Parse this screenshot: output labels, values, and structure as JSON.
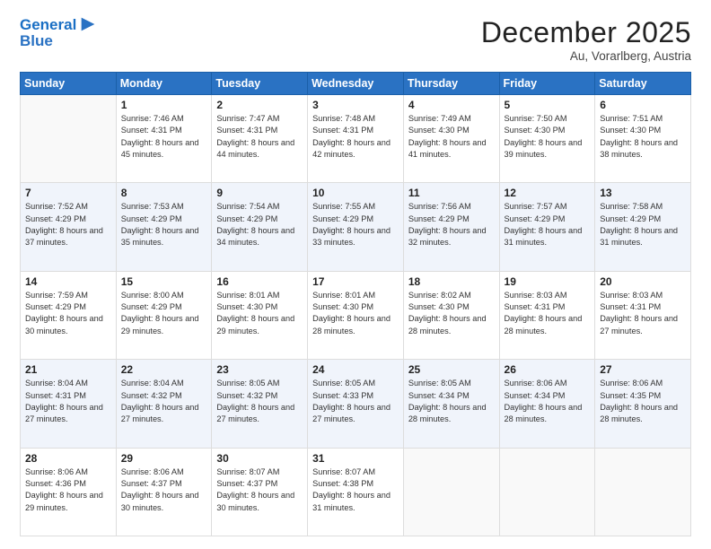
{
  "logo": {
    "line1": "General",
    "line2": "Blue",
    "icon": "▶"
  },
  "header": {
    "month": "December 2025",
    "location": "Au, Vorarlberg, Austria"
  },
  "days": [
    "Sunday",
    "Monday",
    "Tuesday",
    "Wednesday",
    "Thursday",
    "Friday",
    "Saturday"
  ],
  "weeks": [
    [
      {
        "num": "",
        "sunrise": "",
        "sunset": "",
        "daylight": ""
      },
      {
        "num": "1",
        "sunrise": "7:46 AM",
        "sunset": "4:31 PM",
        "daylight": "8 hours and 45 minutes."
      },
      {
        "num": "2",
        "sunrise": "7:47 AM",
        "sunset": "4:31 PM",
        "daylight": "8 hours and 44 minutes."
      },
      {
        "num": "3",
        "sunrise": "7:48 AM",
        "sunset": "4:31 PM",
        "daylight": "8 hours and 42 minutes."
      },
      {
        "num": "4",
        "sunrise": "7:49 AM",
        "sunset": "4:30 PM",
        "daylight": "8 hours and 41 minutes."
      },
      {
        "num": "5",
        "sunrise": "7:50 AM",
        "sunset": "4:30 PM",
        "daylight": "8 hours and 39 minutes."
      },
      {
        "num": "6",
        "sunrise": "7:51 AM",
        "sunset": "4:30 PM",
        "daylight": "8 hours and 38 minutes."
      }
    ],
    [
      {
        "num": "7",
        "sunrise": "7:52 AM",
        "sunset": "4:29 PM",
        "daylight": "8 hours and 37 minutes."
      },
      {
        "num": "8",
        "sunrise": "7:53 AM",
        "sunset": "4:29 PM",
        "daylight": "8 hours and 35 minutes."
      },
      {
        "num": "9",
        "sunrise": "7:54 AM",
        "sunset": "4:29 PM",
        "daylight": "8 hours and 34 minutes."
      },
      {
        "num": "10",
        "sunrise": "7:55 AM",
        "sunset": "4:29 PM",
        "daylight": "8 hours and 33 minutes."
      },
      {
        "num": "11",
        "sunrise": "7:56 AM",
        "sunset": "4:29 PM",
        "daylight": "8 hours and 32 minutes."
      },
      {
        "num": "12",
        "sunrise": "7:57 AM",
        "sunset": "4:29 PM",
        "daylight": "8 hours and 31 minutes."
      },
      {
        "num": "13",
        "sunrise": "7:58 AM",
        "sunset": "4:29 PM",
        "daylight": "8 hours and 31 minutes."
      }
    ],
    [
      {
        "num": "14",
        "sunrise": "7:59 AM",
        "sunset": "4:29 PM",
        "daylight": "8 hours and 30 minutes."
      },
      {
        "num": "15",
        "sunrise": "8:00 AM",
        "sunset": "4:29 PM",
        "daylight": "8 hours and 29 minutes."
      },
      {
        "num": "16",
        "sunrise": "8:01 AM",
        "sunset": "4:30 PM",
        "daylight": "8 hours and 29 minutes."
      },
      {
        "num": "17",
        "sunrise": "8:01 AM",
        "sunset": "4:30 PM",
        "daylight": "8 hours and 28 minutes."
      },
      {
        "num": "18",
        "sunrise": "8:02 AM",
        "sunset": "4:30 PM",
        "daylight": "8 hours and 28 minutes."
      },
      {
        "num": "19",
        "sunrise": "8:03 AM",
        "sunset": "4:31 PM",
        "daylight": "8 hours and 28 minutes."
      },
      {
        "num": "20",
        "sunrise": "8:03 AM",
        "sunset": "4:31 PM",
        "daylight": "8 hours and 27 minutes."
      }
    ],
    [
      {
        "num": "21",
        "sunrise": "8:04 AM",
        "sunset": "4:31 PM",
        "daylight": "8 hours and 27 minutes."
      },
      {
        "num": "22",
        "sunrise": "8:04 AM",
        "sunset": "4:32 PM",
        "daylight": "8 hours and 27 minutes."
      },
      {
        "num": "23",
        "sunrise": "8:05 AM",
        "sunset": "4:32 PM",
        "daylight": "8 hours and 27 minutes."
      },
      {
        "num": "24",
        "sunrise": "8:05 AM",
        "sunset": "4:33 PM",
        "daylight": "8 hours and 27 minutes."
      },
      {
        "num": "25",
        "sunrise": "8:05 AM",
        "sunset": "4:34 PM",
        "daylight": "8 hours and 28 minutes."
      },
      {
        "num": "26",
        "sunrise": "8:06 AM",
        "sunset": "4:34 PM",
        "daylight": "8 hours and 28 minutes."
      },
      {
        "num": "27",
        "sunrise": "8:06 AM",
        "sunset": "4:35 PM",
        "daylight": "8 hours and 28 minutes."
      }
    ],
    [
      {
        "num": "28",
        "sunrise": "8:06 AM",
        "sunset": "4:36 PM",
        "daylight": "8 hours and 29 minutes."
      },
      {
        "num": "29",
        "sunrise": "8:06 AM",
        "sunset": "4:37 PM",
        "daylight": "8 hours and 30 minutes."
      },
      {
        "num": "30",
        "sunrise": "8:07 AM",
        "sunset": "4:37 PM",
        "daylight": "8 hours and 30 minutes."
      },
      {
        "num": "31",
        "sunrise": "8:07 AM",
        "sunset": "4:38 PM",
        "daylight": "8 hours and 31 minutes."
      },
      {
        "num": "",
        "sunrise": "",
        "sunset": "",
        "daylight": ""
      },
      {
        "num": "",
        "sunrise": "",
        "sunset": "",
        "daylight": ""
      },
      {
        "num": "",
        "sunrise": "",
        "sunset": "",
        "daylight": ""
      }
    ]
  ]
}
